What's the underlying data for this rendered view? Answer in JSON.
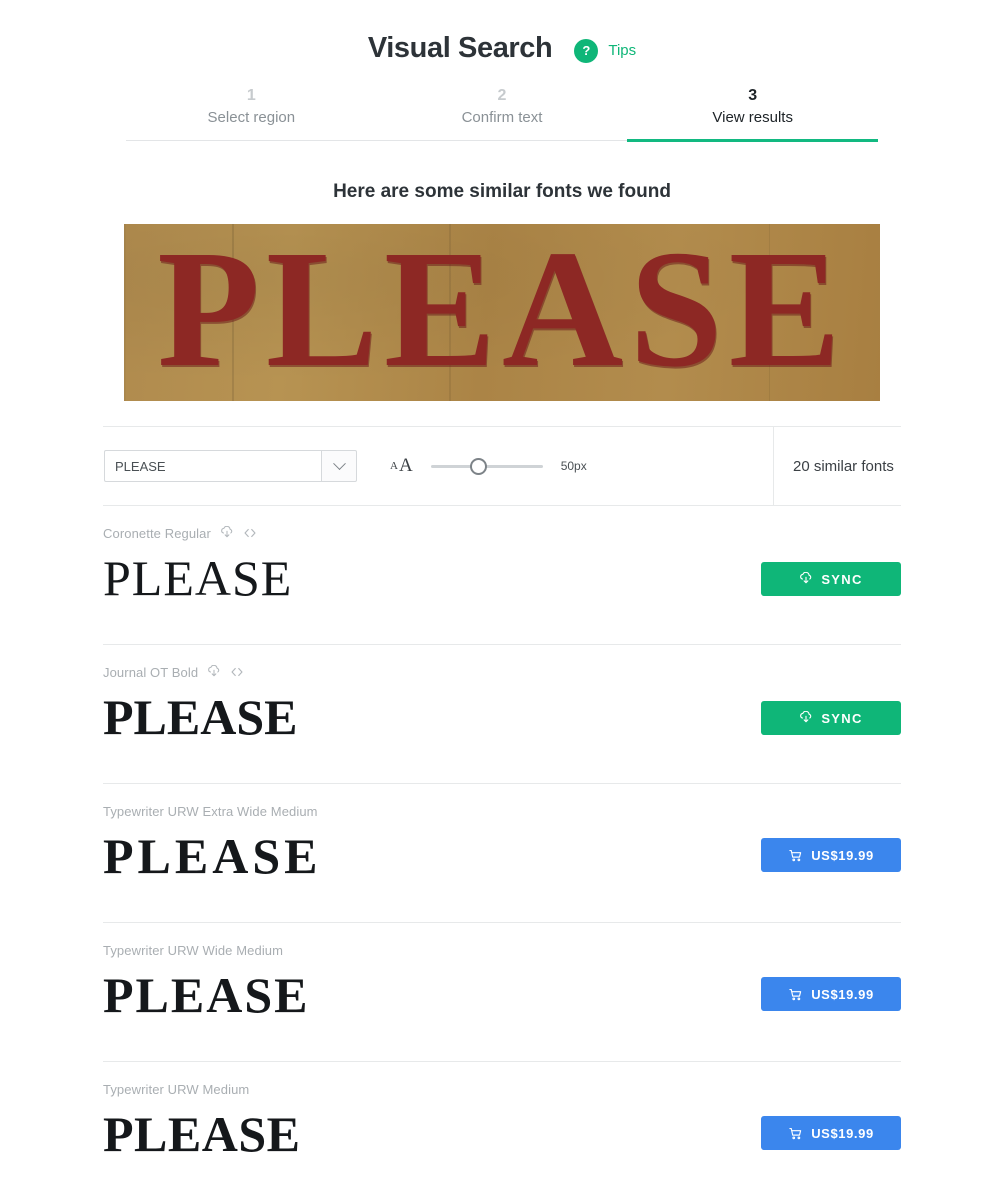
{
  "header": {
    "title": "Visual Search",
    "help_icon": "question-mark-icon",
    "tips_label": "Tips",
    "accent_color": "#0fb678"
  },
  "steps": [
    {
      "num": "1",
      "label": "Select region",
      "active": false
    },
    {
      "num": "2",
      "label": "Confirm text",
      "active": false
    },
    {
      "num": "3",
      "label": "View results",
      "active": true
    }
  ],
  "results": {
    "heading": "Here are some similar fonts we found",
    "count_label": "20 similar fonts"
  },
  "sample_image": {
    "text": "PLEASE",
    "background_color": "#b08b4e",
    "letter_color": "#8d2824",
    "alt": "photo of hand painted sign reading PLEASE"
  },
  "controls": {
    "text_value": "PLEASE",
    "text_placeholder": "Enter sample text",
    "dropdown_icon": "chevron-down-icon",
    "size_small_label": "A",
    "size_large_label": "A",
    "size_value": "50px",
    "slider_percent": 42
  },
  "fonts": [
    {
      "name": "Coronette Regular",
      "preview": "PLEASE",
      "style": "w-reg",
      "has_sync_icon": true,
      "has_code_icon": true,
      "action_type": "sync",
      "action_label": "SYNC",
      "action_icon": "cloud-download-icon"
    },
    {
      "name": "Journal OT Bold",
      "preview": "PLEASE",
      "style": "w-bold",
      "has_sync_icon": true,
      "has_code_icon": true,
      "action_type": "sync",
      "action_label": "SYNC",
      "action_icon": "cloud-download-icon"
    },
    {
      "name": "Typewriter URW Extra Wide Medium",
      "preview": "PLEASE",
      "style": "wide",
      "has_sync_icon": false,
      "has_code_icon": false,
      "action_type": "buy",
      "action_label": "US$19.99",
      "action_icon": "shopping-cart-icon"
    },
    {
      "name": "Typewriter URW Wide Medium",
      "preview": "PLEASE",
      "style": "midwide",
      "has_sync_icon": false,
      "has_code_icon": false,
      "action_type": "buy",
      "action_label": "US$19.99",
      "action_icon": "shopping-cart-icon"
    },
    {
      "name": "Typewriter URW Medium",
      "preview": "PLEASE",
      "style": "narrow",
      "has_sync_icon": false,
      "has_code_icon": false,
      "action_type": "buy",
      "action_label": "US$19.99",
      "action_icon": "shopping-cart-icon"
    }
  ]
}
